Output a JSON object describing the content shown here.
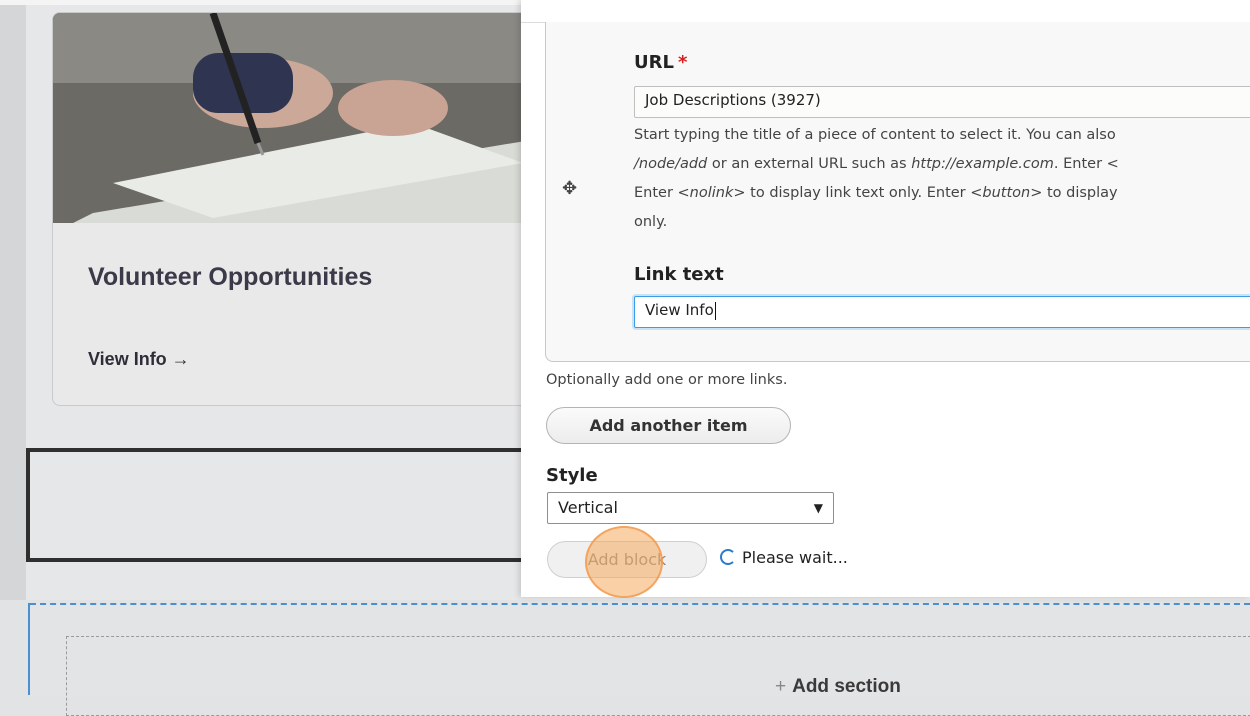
{
  "card": {
    "title": "Volunteer Opportunities",
    "link_label": "View Info →"
  },
  "dialog": {
    "url_field": {
      "label": "URL",
      "required_mark": "*",
      "value": "Job Descriptions (3927)",
      "description": {
        "line1": "Start typing the title of a piece of content to select it. You can also",
        "line2_italic1": "/node/add",
        "line2_mid": " or an external URL such as ",
        "line2_italic2": "http://example.com",
        "line2_end": ". Enter <",
        "line3_start": "Enter ",
        "line3_italic1": "<nolink>",
        "line3_mid": " to display link text only. Enter ",
        "line3_italic2": "<button>",
        "line3_end": " to display",
        "line4": "only."
      }
    },
    "link_text_field": {
      "label": "Link text",
      "value": "View Info"
    },
    "help_text": "Optionally add one or more links.",
    "add_another_label": "Add another item",
    "style_field": {
      "label": "Style",
      "selected": "Vertical"
    },
    "add_block_label": "Add block",
    "wait_text": "Please wait..."
  },
  "add_section_label": "Add section",
  "icons": {
    "drag": "move-icon",
    "spinner": "spinner-icon",
    "plus": "plus-icon"
  },
  "colors": {
    "focus_blue": "#3a9ee6",
    "required_red": "#d32020",
    "section_border": "#4a90d0",
    "click_highlight": "#f5aa5f"
  }
}
